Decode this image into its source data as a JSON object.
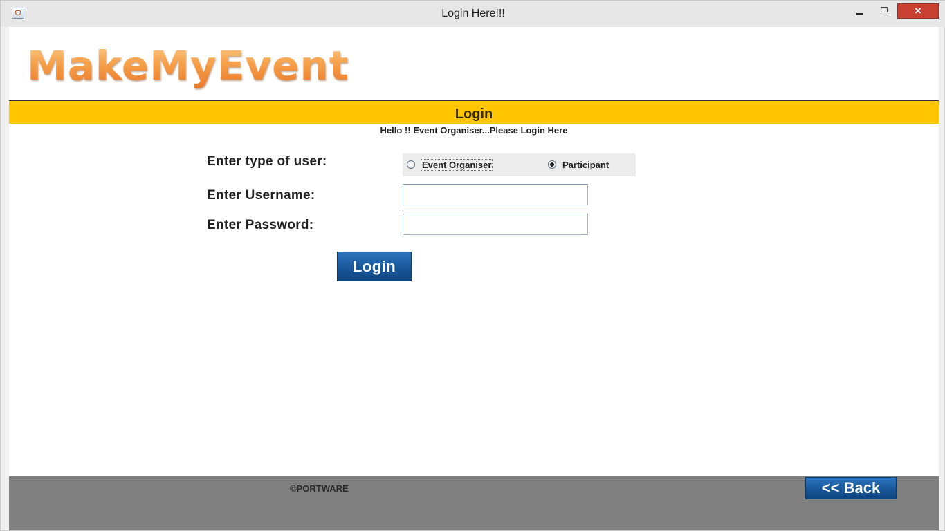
{
  "window": {
    "title": "Login Here!!!",
    "close_glyph": "×"
  },
  "header": {
    "logo_text": "MakeMyEvent"
  },
  "banner": {
    "title": "Login"
  },
  "subtitle": "Hello !! Event Organiser...Please Login Here",
  "form": {
    "user_type_label": "Enter type of user:",
    "user_type_options": [
      {
        "label": "Event Organiser",
        "checked": false
      },
      {
        "label": "Participant",
        "checked": true
      }
    ],
    "username_label": "Enter Username:",
    "username_value": "",
    "password_label": "Enter Password:",
    "password_value": "",
    "login_button": "Login"
  },
  "footer": {
    "copyright": "©PORTWARE",
    "back_button": "<< Back"
  },
  "colors": {
    "banner": "#ffc500",
    "footer": "#808080",
    "button": "#1a5a9e",
    "logo": "#f39a3c"
  }
}
